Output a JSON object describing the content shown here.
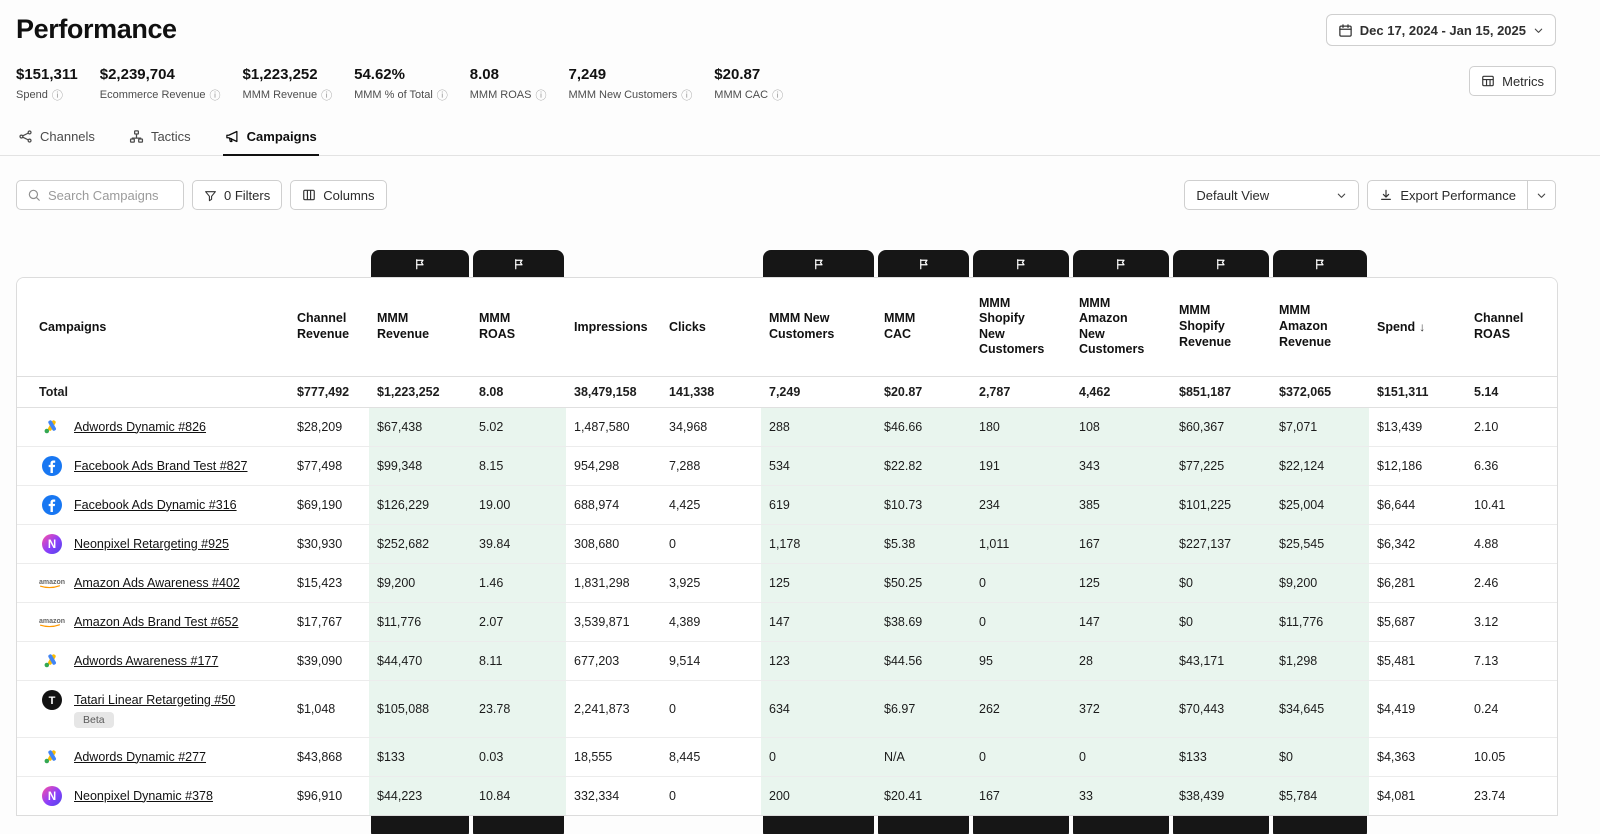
{
  "page": {
    "title": "Performance"
  },
  "header": {
    "date_range": "Dec 17, 2024 - Jan 15, 2025",
    "metrics_button": "Metrics"
  },
  "kpis": [
    {
      "value": "$151,311",
      "label": "Spend"
    },
    {
      "value": "$2,239,704",
      "label": "Ecommerce Revenue"
    },
    {
      "value": "$1,223,252",
      "label": "MMM Revenue"
    },
    {
      "value": "54.62%",
      "label": "MMM % of Total"
    },
    {
      "value": "8.08",
      "label": "MMM ROAS"
    },
    {
      "value": "7,249",
      "label": "MMM New Customers"
    },
    {
      "value": "$20.87",
      "label": "MMM CAC"
    }
  ],
  "tabs": [
    {
      "label": "Channels",
      "icon": "channels",
      "active": false
    },
    {
      "label": "Tactics",
      "icon": "tactics",
      "active": false
    },
    {
      "label": "Campaigns",
      "icon": "campaigns",
      "active": true
    }
  ],
  "toolbar": {
    "search_placeholder": "Search Campaigns",
    "filters_label": "0 Filters",
    "columns_label": "Columns",
    "view_select": "Default View",
    "export_label": "Export Performance"
  },
  "table": {
    "columns": [
      {
        "key": "name",
        "label": "Campaigns",
        "mmm": false
      },
      {
        "key": "channel_revenue",
        "label": "Channel Revenue",
        "mmm": false
      },
      {
        "key": "mmm_revenue",
        "label": "MMM Revenue",
        "mmm": true
      },
      {
        "key": "mmm_roas",
        "label": "MMM ROAS",
        "mmm": true
      },
      {
        "key": "impressions",
        "label": "Impressions",
        "mmm": false
      },
      {
        "key": "clicks",
        "label": "Clicks",
        "mmm": false
      },
      {
        "key": "mmm_new_customers",
        "label": "MMM New Customers",
        "mmm": true
      },
      {
        "key": "mmm_cac",
        "label": "MMM CAC",
        "mmm": true
      },
      {
        "key": "mmm_shopify_new_customers",
        "label": "MMM Shopify New Customers",
        "mmm": true
      },
      {
        "key": "mmm_amazon_new_customers",
        "label": "MMM Amazon New Customers",
        "mmm": true
      },
      {
        "key": "mmm_shopify_revenue",
        "label": "MMM Shopify Revenue",
        "mmm": true
      },
      {
        "key": "mmm_amazon_revenue",
        "label": "MMM Amazon Revenue",
        "mmm": true
      },
      {
        "key": "spend",
        "label": "Spend",
        "sort": "desc",
        "mmm": false
      },
      {
        "key": "channel_roas",
        "label": "Channel ROAS",
        "mmm": false
      }
    ],
    "total": {
      "label": "Total",
      "values": [
        "$777,492",
        "$1,223,252",
        "8.08",
        "38,479,158",
        "141,338",
        "7,249",
        "$20.87",
        "2,787",
        "4,462",
        "$851,187",
        "$372,065",
        "$151,311",
        "5.14"
      ]
    },
    "rows": [
      {
        "name": "Adwords Dynamic #826",
        "icon": "google-ads",
        "values": [
          "$28,209",
          "$67,438",
          "5.02",
          "1,487,580",
          "34,968",
          "288",
          "$46.66",
          "180",
          "108",
          "$60,367",
          "$7,071",
          "$13,439",
          "2.10"
        ]
      },
      {
        "name": "Facebook Ads Brand Test #827",
        "icon": "facebook",
        "values": [
          "$77,498",
          "$99,348",
          "8.15",
          "954,298",
          "7,288",
          "534",
          "$22.82",
          "191",
          "343",
          "$77,225",
          "$22,124",
          "$12,186",
          "6.36"
        ]
      },
      {
        "name": "Facebook Ads Dynamic #316",
        "icon": "facebook",
        "values": [
          "$69,190",
          "$126,229",
          "19.00",
          "688,974",
          "4,425",
          "619",
          "$10.73",
          "234",
          "385",
          "$101,225",
          "$25,004",
          "$6,644",
          "10.41"
        ]
      },
      {
        "name": "Neonpixel Retargeting #925",
        "icon": "neonpixel",
        "values": [
          "$30,930",
          "$252,682",
          "39.84",
          "308,680",
          "0",
          "1,178",
          "$5.38",
          "1,011",
          "167",
          "$227,137",
          "$25,545",
          "$6,342",
          "4.88"
        ]
      },
      {
        "name": "Amazon Ads Awareness #402",
        "icon": "amazon",
        "values": [
          "$15,423",
          "$9,200",
          "1.46",
          "1,831,298",
          "3,925",
          "125",
          "$50.25",
          "0",
          "125",
          "$0",
          "$9,200",
          "$6,281",
          "2.46"
        ]
      },
      {
        "name": "Amazon Ads Brand Test #652",
        "icon": "amazon",
        "values": [
          "$17,767",
          "$11,776",
          "2.07",
          "3,539,871",
          "4,389",
          "147",
          "$38.69",
          "0",
          "147",
          "$0",
          "$11,776",
          "$5,687",
          "3.12"
        ]
      },
      {
        "name": "Adwords Awareness #177",
        "icon": "google-ads",
        "values": [
          "$39,090",
          "$44,470",
          "8.11",
          "677,203",
          "9,514",
          "123",
          "$44.56",
          "95",
          "28",
          "$43,171",
          "$1,298",
          "$5,481",
          "7.13"
        ]
      },
      {
        "name": "Tatari Linear Retargeting #50",
        "icon": "tatari",
        "badge": "Beta",
        "values": [
          "$1,048",
          "$105,088",
          "23.78",
          "2,241,873",
          "0",
          "634",
          "$6.97",
          "262",
          "372",
          "$70,443",
          "$34,645",
          "$4,419",
          "0.24"
        ]
      },
      {
        "name": "Adwords Dynamic #277",
        "icon": "google-ads",
        "values": [
          "$43,868",
          "$133",
          "0.03",
          "18,555",
          "8,445",
          "0",
          "N/A",
          "0",
          "0",
          "$133",
          "$0",
          "$4,363",
          "10.05"
        ]
      },
      {
        "name": "Neonpixel Dynamic #378",
        "icon": "neonpixel",
        "values": [
          "$96,910",
          "$44,223",
          "10.84",
          "332,334",
          "0",
          "200",
          "$20.41",
          "167",
          "33",
          "$38,439",
          "$5,784",
          "$4,081",
          "23.74"
        ]
      }
    ]
  },
  "colors": {
    "mmm_tint": "#e9f5ee",
    "chip_bg": "#161616",
    "facebook_blue": "#1877F2",
    "amazon_orange": "#FF9900"
  }
}
